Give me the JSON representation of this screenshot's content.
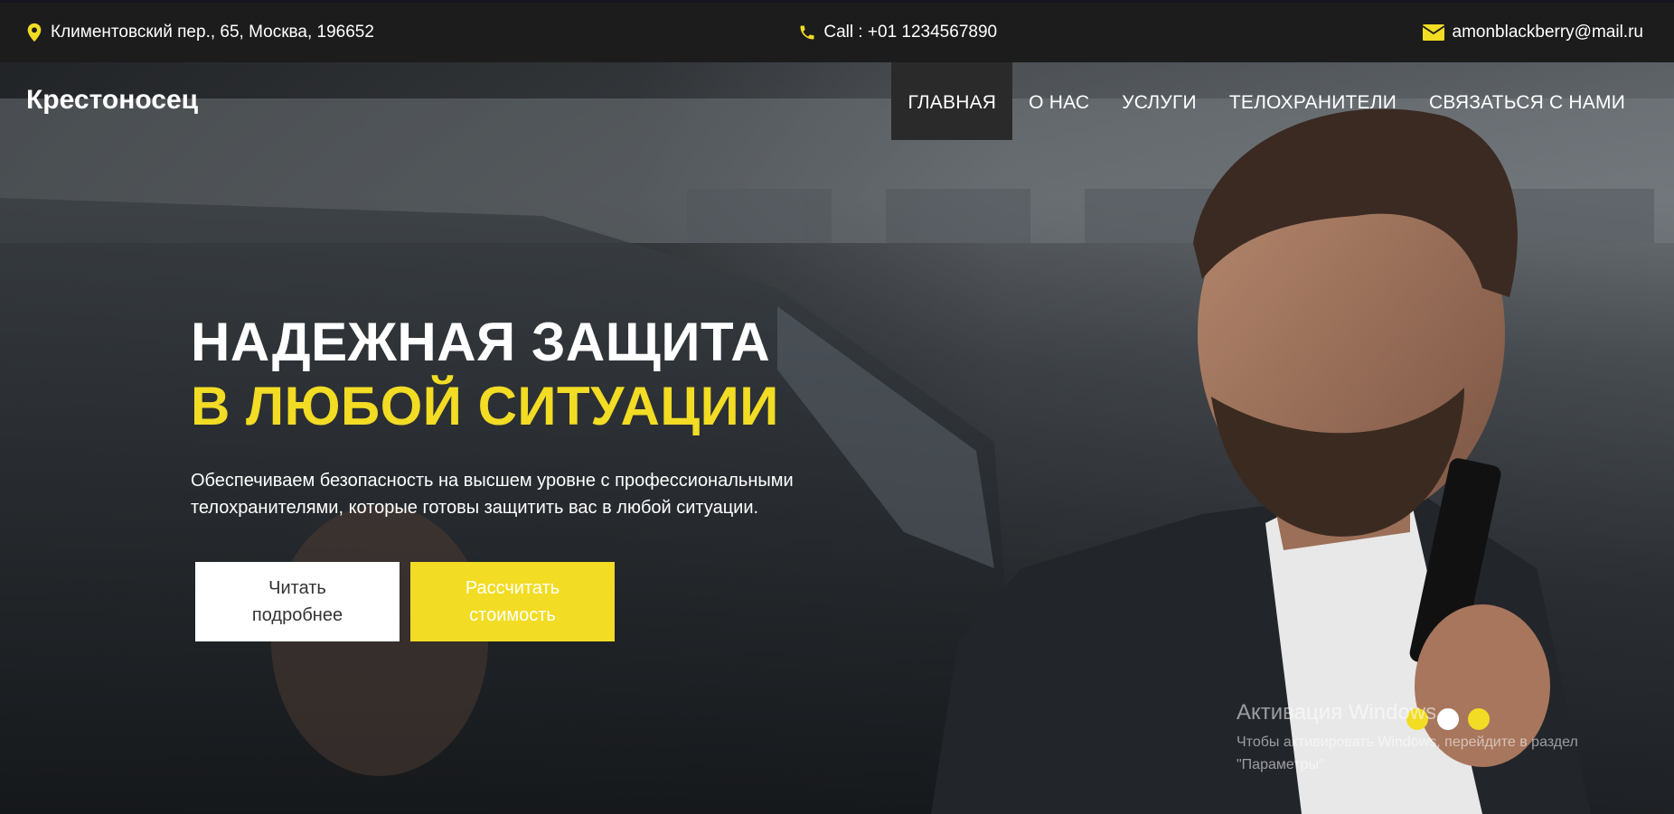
{
  "topbar": {
    "address": "Климентовский пер., 65, Москва, 196652",
    "phone": "Call : +01 1234567890",
    "email": "amonblackberry@mail.ru"
  },
  "header": {
    "brand": "Крестоносец",
    "nav": [
      {
        "label": "ГЛАВНАЯ",
        "active": true
      },
      {
        "label": "О НАС"
      },
      {
        "label": "УСЛУГИ"
      },
      {
        "label": "ТЕЛОХРАНИТЕЛИ"
      },
      {
        "label": "СВЯЗАТЬСЯ С НАМИ"
      }
    ]
  },
  "hero": {
    "title_line1": "НАДЕЖНАЯ ЗАЩИТА",
    "title_line2": "В ЛЮБОЙ СИТУАЦИИ",
    "description": "Обеспечиваем безопасность на высшем уровне с профессиональными телохранителями, которые готовы защитить вас в любой ситуации.",
    "button_read": "Читать подробнее",
    "button_calc": "Рассчитать стоимость"
  },
  "carousel": {
    "dots": [
      "#f2dc24",
      "#ffffff",
      "#f2dc24"
    ]
  },
  "watermark": {
    "title": "Активация Windows",
    "text": "Чтобы активировать Windows, перейдите в раздел \"Параметры\"."
  },
  "colors": {
    "accent": "#f2dc24",
    "topbar_bg": "#1c1c1c"
  }
}
